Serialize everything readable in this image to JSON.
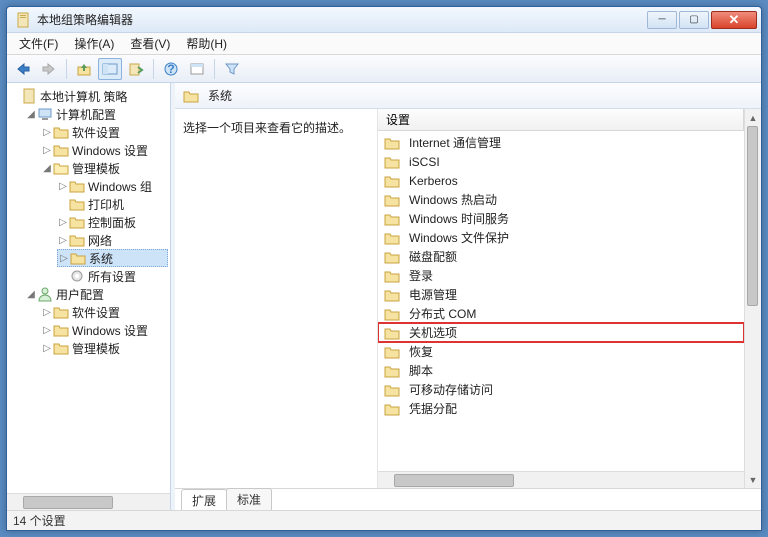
{
  "window": {
    "title": "本地组策略编辑器"
  },
  "menu": {
    "file": "文件(F)",
    "action": "操作(A)",
    "view": "查看(V)",
    "help": "帮助(H)"
  },
  "tree": {
    "root": "本地计算机 策略",
    "computer": "计算机配置",
    "software": "软件设置",
    "windows": "Windows 设置",
    "admin": "管理模板",
    "admin_windows": "Windows 组",
    "admin_printers": "打印机",
    "admin_cpl": "控制面板",
    "admin_net": "网络",
    "admin_system": "系统",
    "admin_all": "所有设置",
    "user": "用户配置",
    "u_software": "软件设置",
    "u_windows": "Windows 设置",
    "u_admin": "管理模板"
  },
  "pane": {
    "header": "系统",
    "desc": "选择一个项目来查看它的描述。",
    "setting_col": "设置"
  },
  "items": [
    "Internet 通信管理",
    "iSCSI",
    "Kerberos",
    "Windows 热启动",
    "Windows 时间服务",
    "Windows 文件保护",
    "磁盘配额",
    "登录",
    "电源管理",
    "分布式 COM",
    "关机选项",
    "恢复",
    "脚本",
    "可移动存储访问",
    "凭据分配"
  ],
  "highlight_index": 10,
  "tabs": {
    "ext": "扩展",
    "std": "标准"
  },
  "status": "14 个设置"
}
